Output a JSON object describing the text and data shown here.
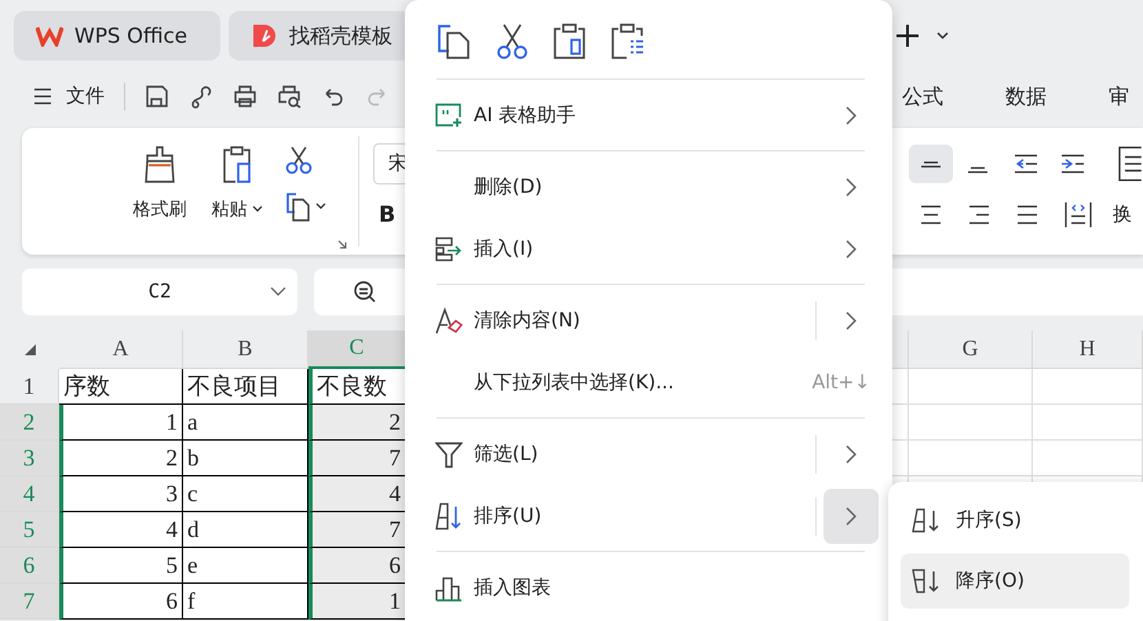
{
  "tabs": [
    {
      "label": "WPS Office",
      "kind": "wps"
    },
    {
      "label": "找稻壳模板",
      "kind": "docer"
    }
  ],
  "file_menu": "文件",
  "ribbon_tabs": [
    "公式",
    "数据",
    "审"
  ],
  "ribbon": {
    "format_painter": "格式刷",
    "paste": "粘贴",
    "font": "宋",
    "bold": "B",
    "wrap": "换"
  },
  "alignment": [
    {
      "kind": "middle",
      "selected": true
    },
    {
      "kind": "bottom",
      "selected": false
    },
    {
      "kind": "outdent",
      "selected": false
    },
    {
      "kind": "indent",
      "selected": false
    }
  ],
  "name_box": "C2",
  "grid": {
    "columns": [
      {
        "label": "A",
        "selected": false
      },
      {
        "label": "B",
        "selected": false
      },
      {
        "label": "C",
        "selected": true
      },
      {
        "label": "G",
        "selected": false
      },
      {
        "label": "H",
        "selected": false
      }
    ],
    "rows": [
      {
        "number": "1",
        "selected": false,
        "cells": [
          "序数",
          "不良项目",
          "不良数"
        ]
      },
      {
        "number": "2",
        "selected": true,
        "cells": [
          "1",
          "a",
          "2"
        ]
      },
      {
        "number": "3",
        "selected": true,
        "cells": [
          "2",
          "b",
          "7"
        ]
      },
      {
        "number": "4",
        "selected": true,
        "cells": [
          "3",
          "c",
          "4"
        ]
      },
      {
        "number": "5",
        "selected": true,
        "cells": [
          "4",
          "d",
          "7"
        ]
      },
      {
        "number": "6",
        "selected": true,
        "cells": [
          "5",
          "e",
          "6"
        ]
      },
      {
        "number": "7",
        "selected": true,
        "cells": [
          "6",
          "f",
          "1"
        ]
      }
    ]
  },
  "context_menu": {
    "items": [
      {
        "kind": "ai",
        "label": "AI 表格助手",
        "submenu": true,
        "split": false,
        "highlighted": false
      },
      {
        "kind": "separator"
      },
      {
        "kind": "plain",
        "label": "删除(D)",
        "submenu": true,
        "split": false,
        "highlighted": false
      },
      {
        "kind": "insert",
        "label": "插入(I)",
        "submenu": true,
        "split": false,
        "highlighted": false
      },
      {
        "kind": "separator"
      },
      {
        "kind": "clear",
        "label": "清除内容(N)",
        "submenu": true,
        "split": true,
        "highlighted": false
      },
      {
        "kind": "plain",
        "label": "从下拉列表中选择(K)...",
        "shortcut": "Alt+↓",
        "submenu": false,
        "split": false
      },
      {
        "kind": "separator"
      },
      {
        "kind": "filter",
        "label": "筛选(L)",
        "submenu": true,
        "split": true,
        "highlighted": false
      },
      {
        "kind": "sort",
        "label": "排序(U)",
        "submenu": true,
        "split": true,
        "highlighted": true
      },
      {
        "kind": "separator"
      },
      {
        "kind": "chart",
        "label": "插入图表",
        "submenu": false,
        "split": false
      }
    ]
  },
  "submenu": [
    {
      "kind": "ascending",
      "label": "升序(S)",
      "selected": false
    },
    {
      "kind": "descending",
      "label": "降序(O)",
      "selected": true
    }
  ]
}
